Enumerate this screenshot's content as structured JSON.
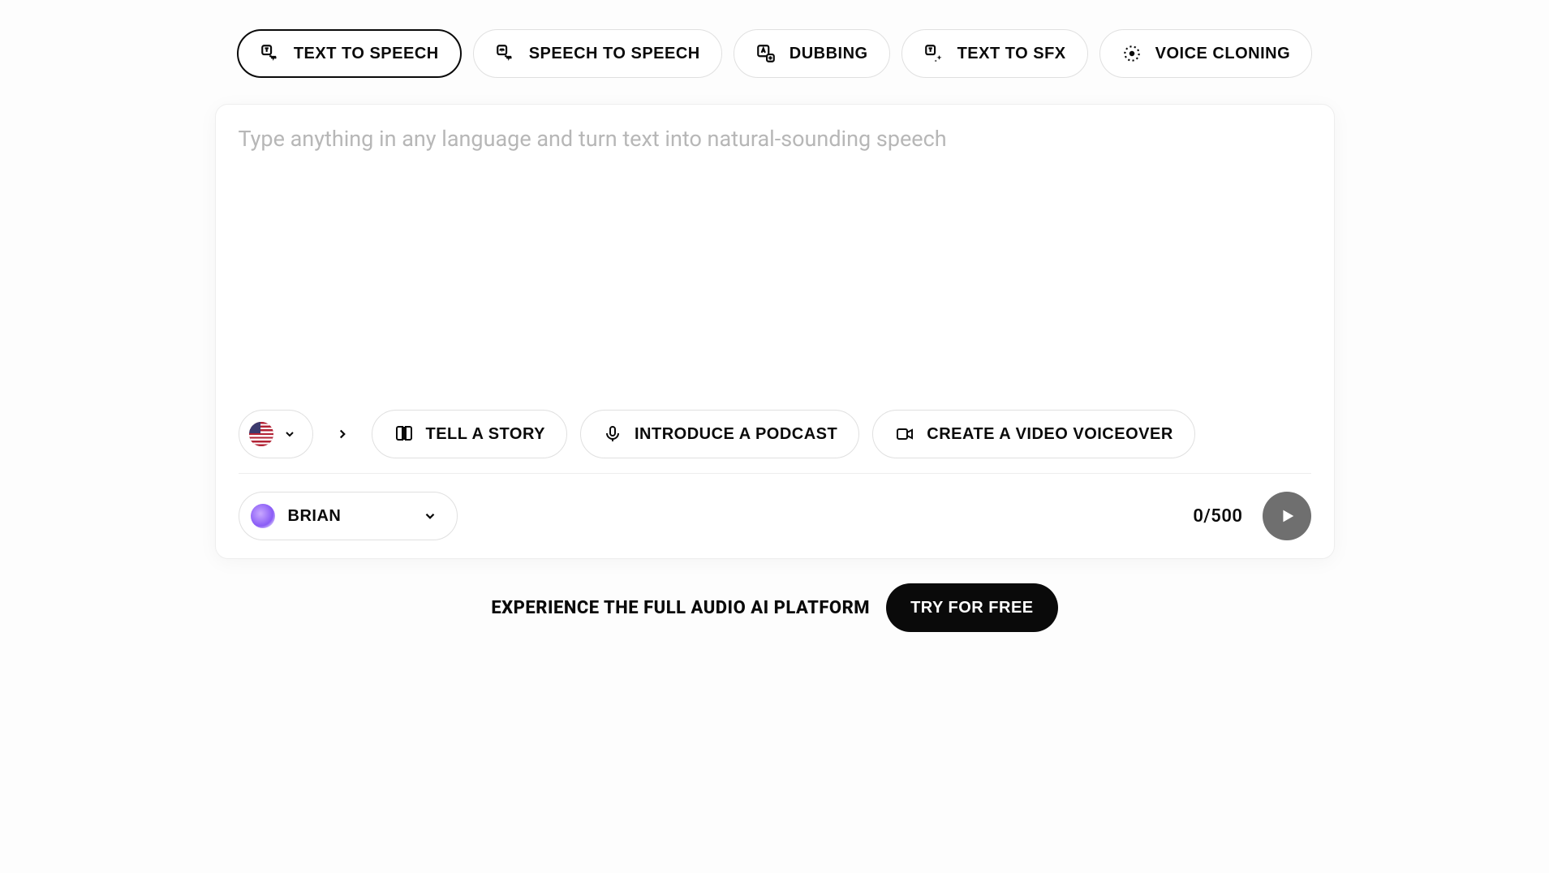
{
  "tabs": [
    {
      "label": "TEXT TO SPEECH",
      "active": true,
      "icon": "tts-icon"
    },
    {
      "label": "SPEECH TO SPEECH",
      "active": false,
      "icon": "sts-icon"
    },
    {
      "label": "DUBBING",
      "active": false,
      "icon": "dubbing-icon"
    },
    {
      "label": "TEXT TO SFX",
      "active": false,
      "icon": "sfx-icon"
    },
    {
      "label": "VOICE CLONING",
      "active": false,
      "icon": "clone-icon"
    }
  ],
  "textarea": {
    "placeholder": "Type anything in any language and turn text into natural-sounding speech",
    "value": ""
  },
  "language": {
    "flag_name": "us-flag"
  },
  "suggestions": [
    {
      "label": "TELL A STORY",
      "icon": "book-icon"
    },
    {
      "label": "INTRODUCE A PODCAST",
      "icon": "mic-icon"
    },
    {
      "label": "CREATE A VIDEO VOICEOVER",
      "icon": "video-icon"
    }
  ],
  "voice": {
    "name": "BRIAN"
  },
  "counter": {
    "current": 0,
    "max": 500,
    "display": "0/500"
  },
  "cta": {
    "text": "EXPERIENCE THE FULL AUDIO AI PLATFORM",
    "button": "TRY FOR FREE"
  }
}
